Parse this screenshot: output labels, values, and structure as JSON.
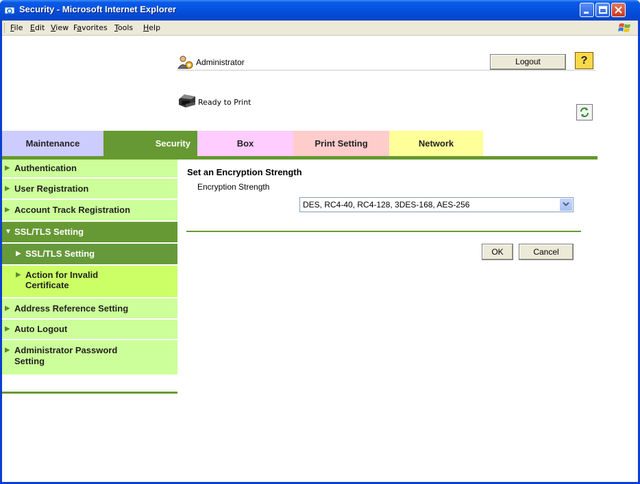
{
  "window": {
    "title": "Security - Microsoft Internet Explorer"
  },
  "menubar": {
    "items": [
      {
        "label": "File",
        "accel": "F"
      },
      {
        "label": "Edit",
        "accel": "E"
      },
      {
        "label": "View",
        "accel": "V"
      },
      {
        "label": "Favorites",
        "accel": "a"
      },
      {
        "label": "Tools",
        "accel": "T"
      },
      {
        "label": "Help",
        "accel": "H"
      }
    ]
  },
  "header": {
    "user": "Administrator",
    "logout_label": "Logout",
    "help_label": "?",
    "status": "Ready to Print"
  },
  "tabs": [
    {
      "label": "Maintenance",
      "color": "#ccccff"
    },
    {
      "label": "Security",
      "color": "#669933"
    },
    {
      "label": "Box",
      "color": "#ffccff"
    },
    {
      "label": "Print Setting",
      "color": "#ffcccc"
    },
    {
      "label": "Network",
      "color": "#ffff99"
    }
  ],
  "sidebar": {
    "items": [
      {
        "label": "Authentication"
      },
      {
        "label": "User Registration"
      },
      {
        "label": "Account Track Registration"
      },
      {
        "label": "SSL/TLS Setting"
      },
      {
        "label": "SSL/TLS Setting"
      },
      {
        "label": "Action for Invalid Certificate"
      },
      {
        "label": "Address Reference Setting"
      },
      {
        "label": "Auto Logout"
      },
      {
        "label": "Administrator Password Setting"
      }
    ]
  },
  "main": {
    "section_title": "Set an Encryption Strength",
    "field_label": "Encryption Strength",
    "encryption_value": "DES, RC4-40, RC4-128, 3DES-168, AES-256",
    "ok_label": "OK",
    "cancel_label": "Cancel"
  },
  "colors": {
    "accent_green": "#669933",
    "sidebar_light": "#ccff99",
    "titlebar_blue": "#0554e2"
  }
}
